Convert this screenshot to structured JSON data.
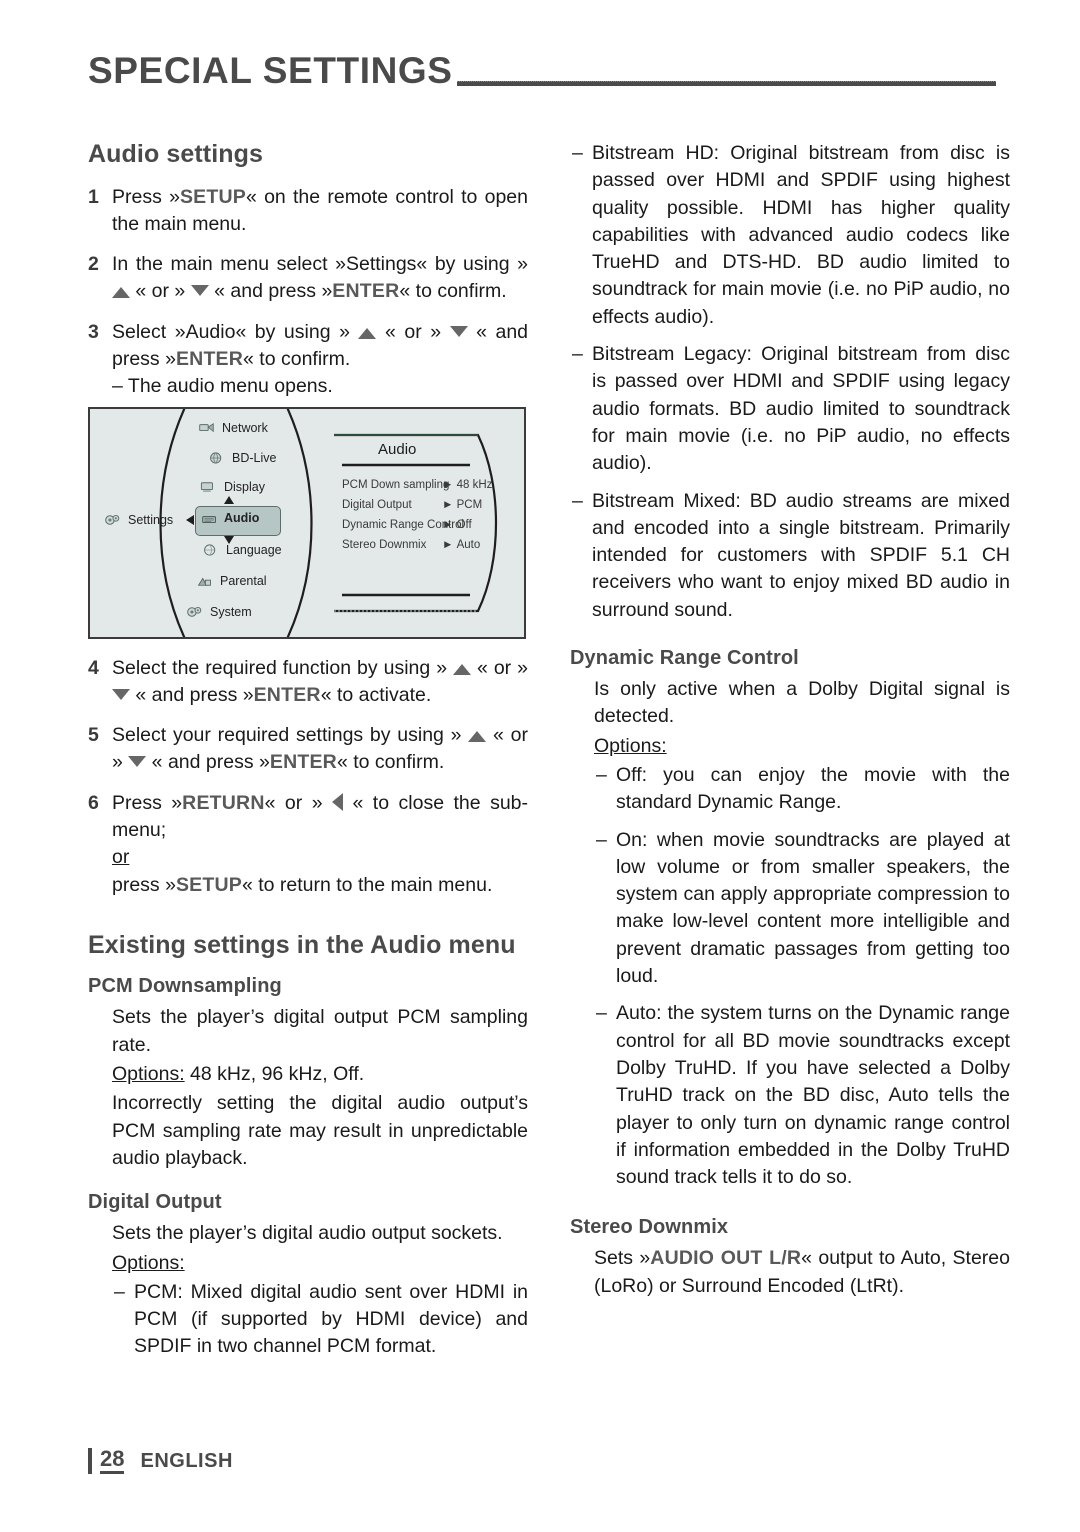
{
  "header": {
    "title": "SPECIAL SETTINGS"
  },
  "footer": {
    "page_number": "28",
    "language": "ENGLISH"
  },
  "left_column": {
    "section_title": "Audio settings",
    "steps": [
      {
        "num": "1",
        "html": "Press »<b class=\"kbd\">SETUP</b>« on the remote control to open the main menu."
      },
      {
        "num": "2",
        "html": "In the main menu select »Settings« by using » <i class=\"arr arr-up\"></i> « or » <i class=\"arr arr-dn\"></i> « and press »<b class=\"kbd\">ENTER</b>« to confirm."
      },
      {
        "num": "3",
        "html": "Select »Audio« by using » <i class=\"arr arr-up\"></i> « or » <i class=\"arr arr-dn\"></i> « and press »<b class=\"kbd\">ENTER</b>« to confirm."
      }
    ],
    "step3_note": "– The audio menu opens.",
    "steps_after_figure": [
      {
        "num": "4",
        "html": "Select the required function by using » <i class=\"arr arr-up\"></i> « or » <i class=\"arr arr-dn\"></i> « and press »<b class=\"kbd\">ENTER</b>« to activate."
      },
      {
        "num": "5",
        "html": "Select your required settings by using » <i class=\"arr arr-up\"></i> « or » <i class=\"arr arr-dn\"></i> « and press »<b class=\"kbd\">ENTER</b>« to confirm."
      },
      {
        "num": "6",
        "html": "Press »<b class=\"kbd\">RETURN</b>« or » <i class=\"arr arr-lf\"></i> « to close the sub-menu;<br><span class=\"uline\">or</span><br>press »<b class=\"kbd\">SETUP</b>« to return to the main menu."
      }
    ],
    "section2_title": "Existing settings in the Audio menu",
    "pcm": {
      "heading": "PCM Downsampling",
      "line1": "Sets the player’s digital output PCM sampling rate.",
      "options_label": "Options:",
      "options_value": " 48 kHz, 96 kHz, Off.",
      "line2": "Incorrectly setting the digital audio output’s PCM sampling rate may result in unpredictable audio playback."
    },
    "digital_output": {
      "heading": "Digital Output",
      "line1": "Sets the player’s digital audio output sockets.",
      "options_label": "Options:",
      "bullet1": "PCM: Mixed digital audio sent over HDMI in PCM (if supported by HDMI device) and SPDIF in two channel PCM format."
    }
  },
  "right_column": {
    "digital_output_bullets": [
      "Bitstream HD: Original bitstream from disc is passed over HDMI and SPDIF using highest quality possible. HDMI has higher quality capabilities with advanced audio codecs like TrueHD and DTS-HD. BD audio limited to soundtrack for main movie (i.e. no PiP audio, no effects audio).",
      "Bitstream Legacy: Original bitstream from disc is passed over HDMI and SPDIF using legacy audio formats. BD audio limited to soundtrack for main movie (i.e. no PiP audio, no effects audio).",
      "Bitstream Mixed: BD audio streams are mixed and encoded into a single bitstream. Primarily intended for customers with SPDIF 5.1 CH receivers who want to enjoy mixed BD audio in surround sound."
    ],
    "drc": {
      "heading": "Dynamic Range Control",
      "line1": "Is only active when a Dolby Digital signal is detected.",
      "options_label": "Options:",
      "bullets": [
        "Off: you can enjoy the movie with the standard Dynamic Range.",
        "On: when movie soundtracks are played at low volume or from smaller speakers, the system can apply appropriate compression to make low-level content more intelligible and prevent dramatic passages from getting too loud.",
        "Auto: the system turns on the Dynamic range control for all BD movie soundtracks except Dolby TruHD. If you have selected a Dolby TruHD track on the BD disc, Auto tells the player to only turn on dynamic range control if information embedded in the Dolby TruHD sound track tells it to do so."
      ]
    },
    "stereo_downmix": {
      "heading": "Stereo Downmix",
      "text_html": "Sets »<b class=\"kbd\">AUDIO OUT L/R</b>« output to Auto, Stereo (LoRo) or Surround Encoded (LtRt)."
    }
  },
  "osd_figure": {
    "root_label": "Settings",
    "menu_items": [
      "Network",
      "BD-Live",
      "Display",
      "Audio",
      "Language",
      "Parental",
      "System"
    ],
    "selected_item": "Audio",
    "panel_title": "Audio",
    "rows": [
      {
        "label": "PCM Down sampling",
        "value": "48 kHz"
      },
      {
        "label": "Digital Output",
        "value": "PCM"
      },
      {
        "label": "Dynamic Range Control",
        "value": "Off"
      },
      {
        "label": "Stereo Downmix",
        "value": "Auto"
      }
    ],
    "value_marker": "►",
    "colors": {
      "panel_bg": "#e3e9e8",
      "selection_bg": "#b6c6c4",
      "frame": "#3b3b3b"
    }
  }
}
